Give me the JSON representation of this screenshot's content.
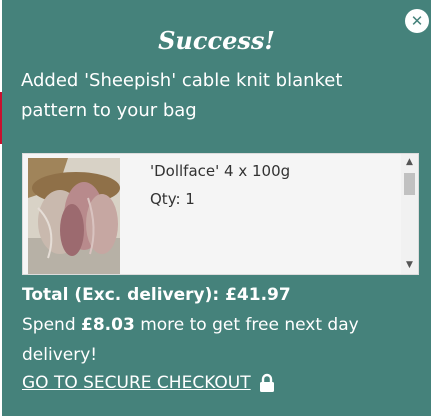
{
  "popup": {
    "title": "Success!",
    "message": "Added 'Sheepish' cable knit blanket pattern to your bag",
    "close_icon": "close-icon",
    "items": [
      {
        "name": "'Dollface' 4 x 100g",
        "qty": "Qty: 1",
        "thumbnail": "yarn-skeins-image"
      }
    ],
    "total_label": "Total (Exc. delivery):",
    "total_value": "£41.97",
    "spend_prefix": "Spend",
    "spend_amount": "£8.03",
    "spend_suffix": "more to get free next day delivery!",
    "checkout_label": "GO TO SECURE CHECKOUT",
    "checkout_icon": "lock-icon",
    "colors": {
      "background": "#45827b",
      "text": "#ffffff",
      "list_background": "#f5f5f5"
    }
  }
}
